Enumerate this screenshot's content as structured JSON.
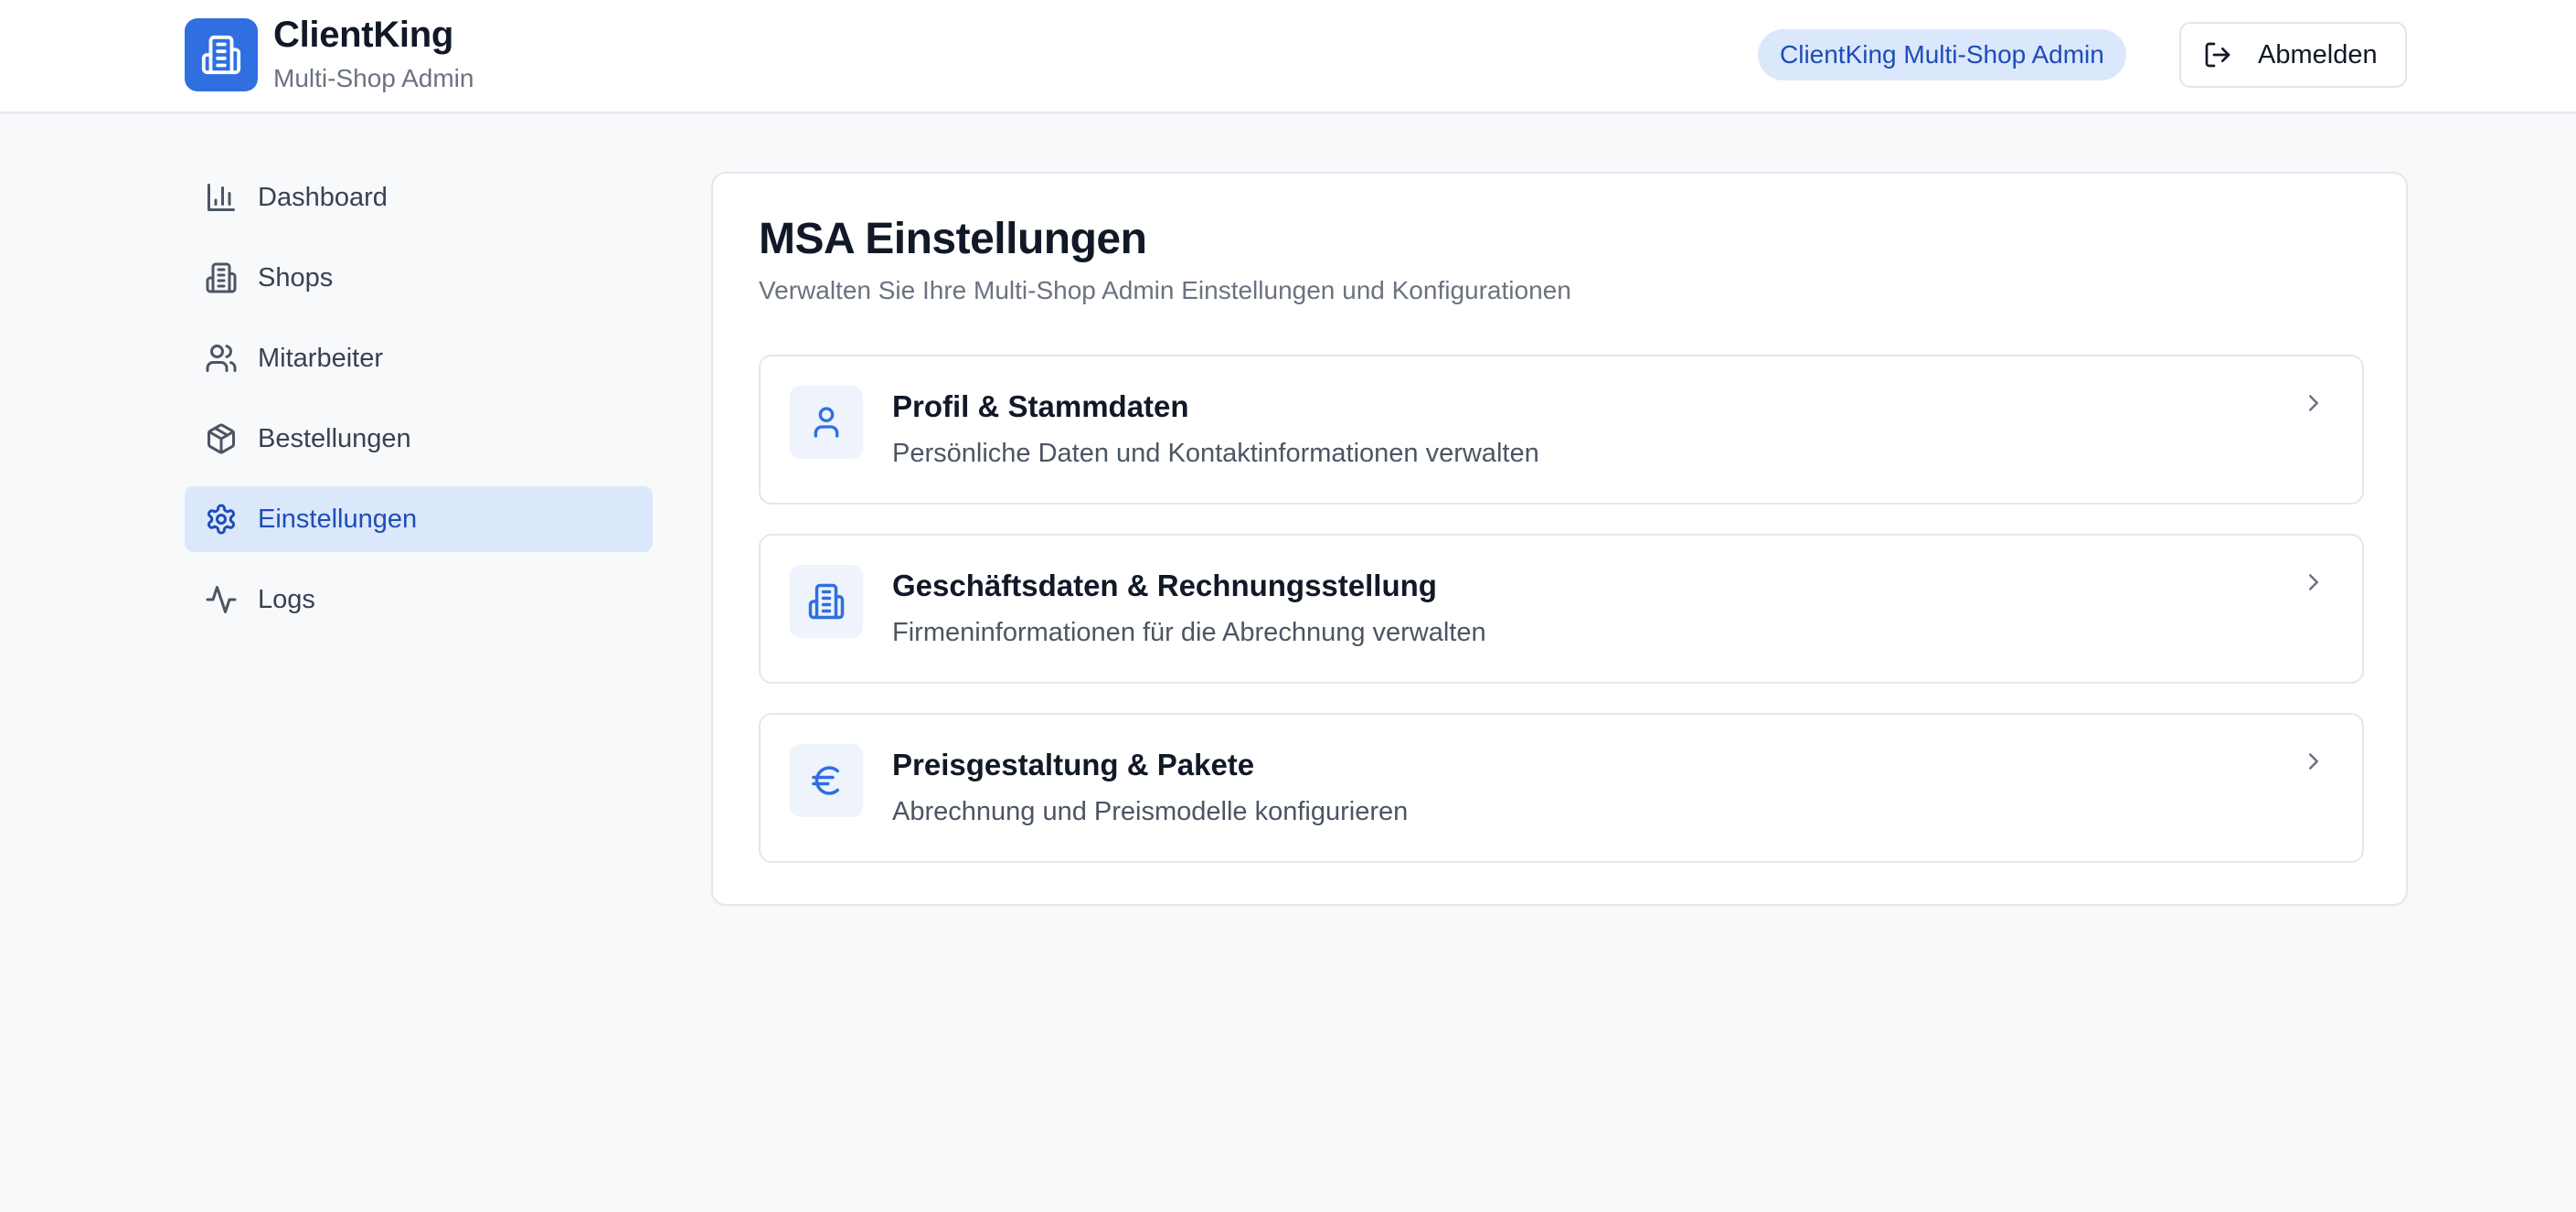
{
  "app": {
    "name": "ClientKing",
    "subtitle": "Multi-Shop Admin",
    "role_badge": "ClientKing Multi-Shop Admin",
    "logout_label": "Abmelden"
  },
  "sidebar": {
    "items": [
      {
        "label": "Dashboard",
        "icon": "bar-chart-icon",
        "active": false
      },
      {
        "label": "Shops",
        "icon": "building-icon",
        "active": false
      },
      {
        "label": "Mitarbeiter",
        "icon": "users-icon",
        "active": false
      },
      {
        "label": "Bestellungen",
        "icon": "package-icon",
        "active": false
      },
      {
        "label": "Einstellungen",
        "icon": "gear-icon",
        "active": true
      },
      {
        "label": "Logs",
        "icon": "activity-icon",
        "active": false
      }
    ]
  },
  "main": {
    "title": "MSA Einstellungen",
    "subtitle": "Verwalten Sie Ihre Multi-Shop Admin Einstellungen und Konfigurationen",
    "sections": [
      {
        "title": "Profil & Stammdaten",
        "description": "Persönliche Daten und Kontaktinformationen verwalten",
        "icon": "user-icon"
      },
      {
        "title": "Geschäftsdaten & Rechnungsstellung",
        "description": "Firmeninformationen für die Abrechnung verwalten",
        "icon": "building-icon"
      },
      {
        "title": "Preisgestaltung & Pakete",
        "description": "Abrechnung und Preismodelle konfigurieren",
        "icon": "euro-icon"
      }
    ]
  },
  "colors": {
    "accent": "#2f6fe0",
    "accent_soft": "#dbe7fb",
    "accent_text": "#1e4db7",
    "background": "#f8f9fb"
  }
}
